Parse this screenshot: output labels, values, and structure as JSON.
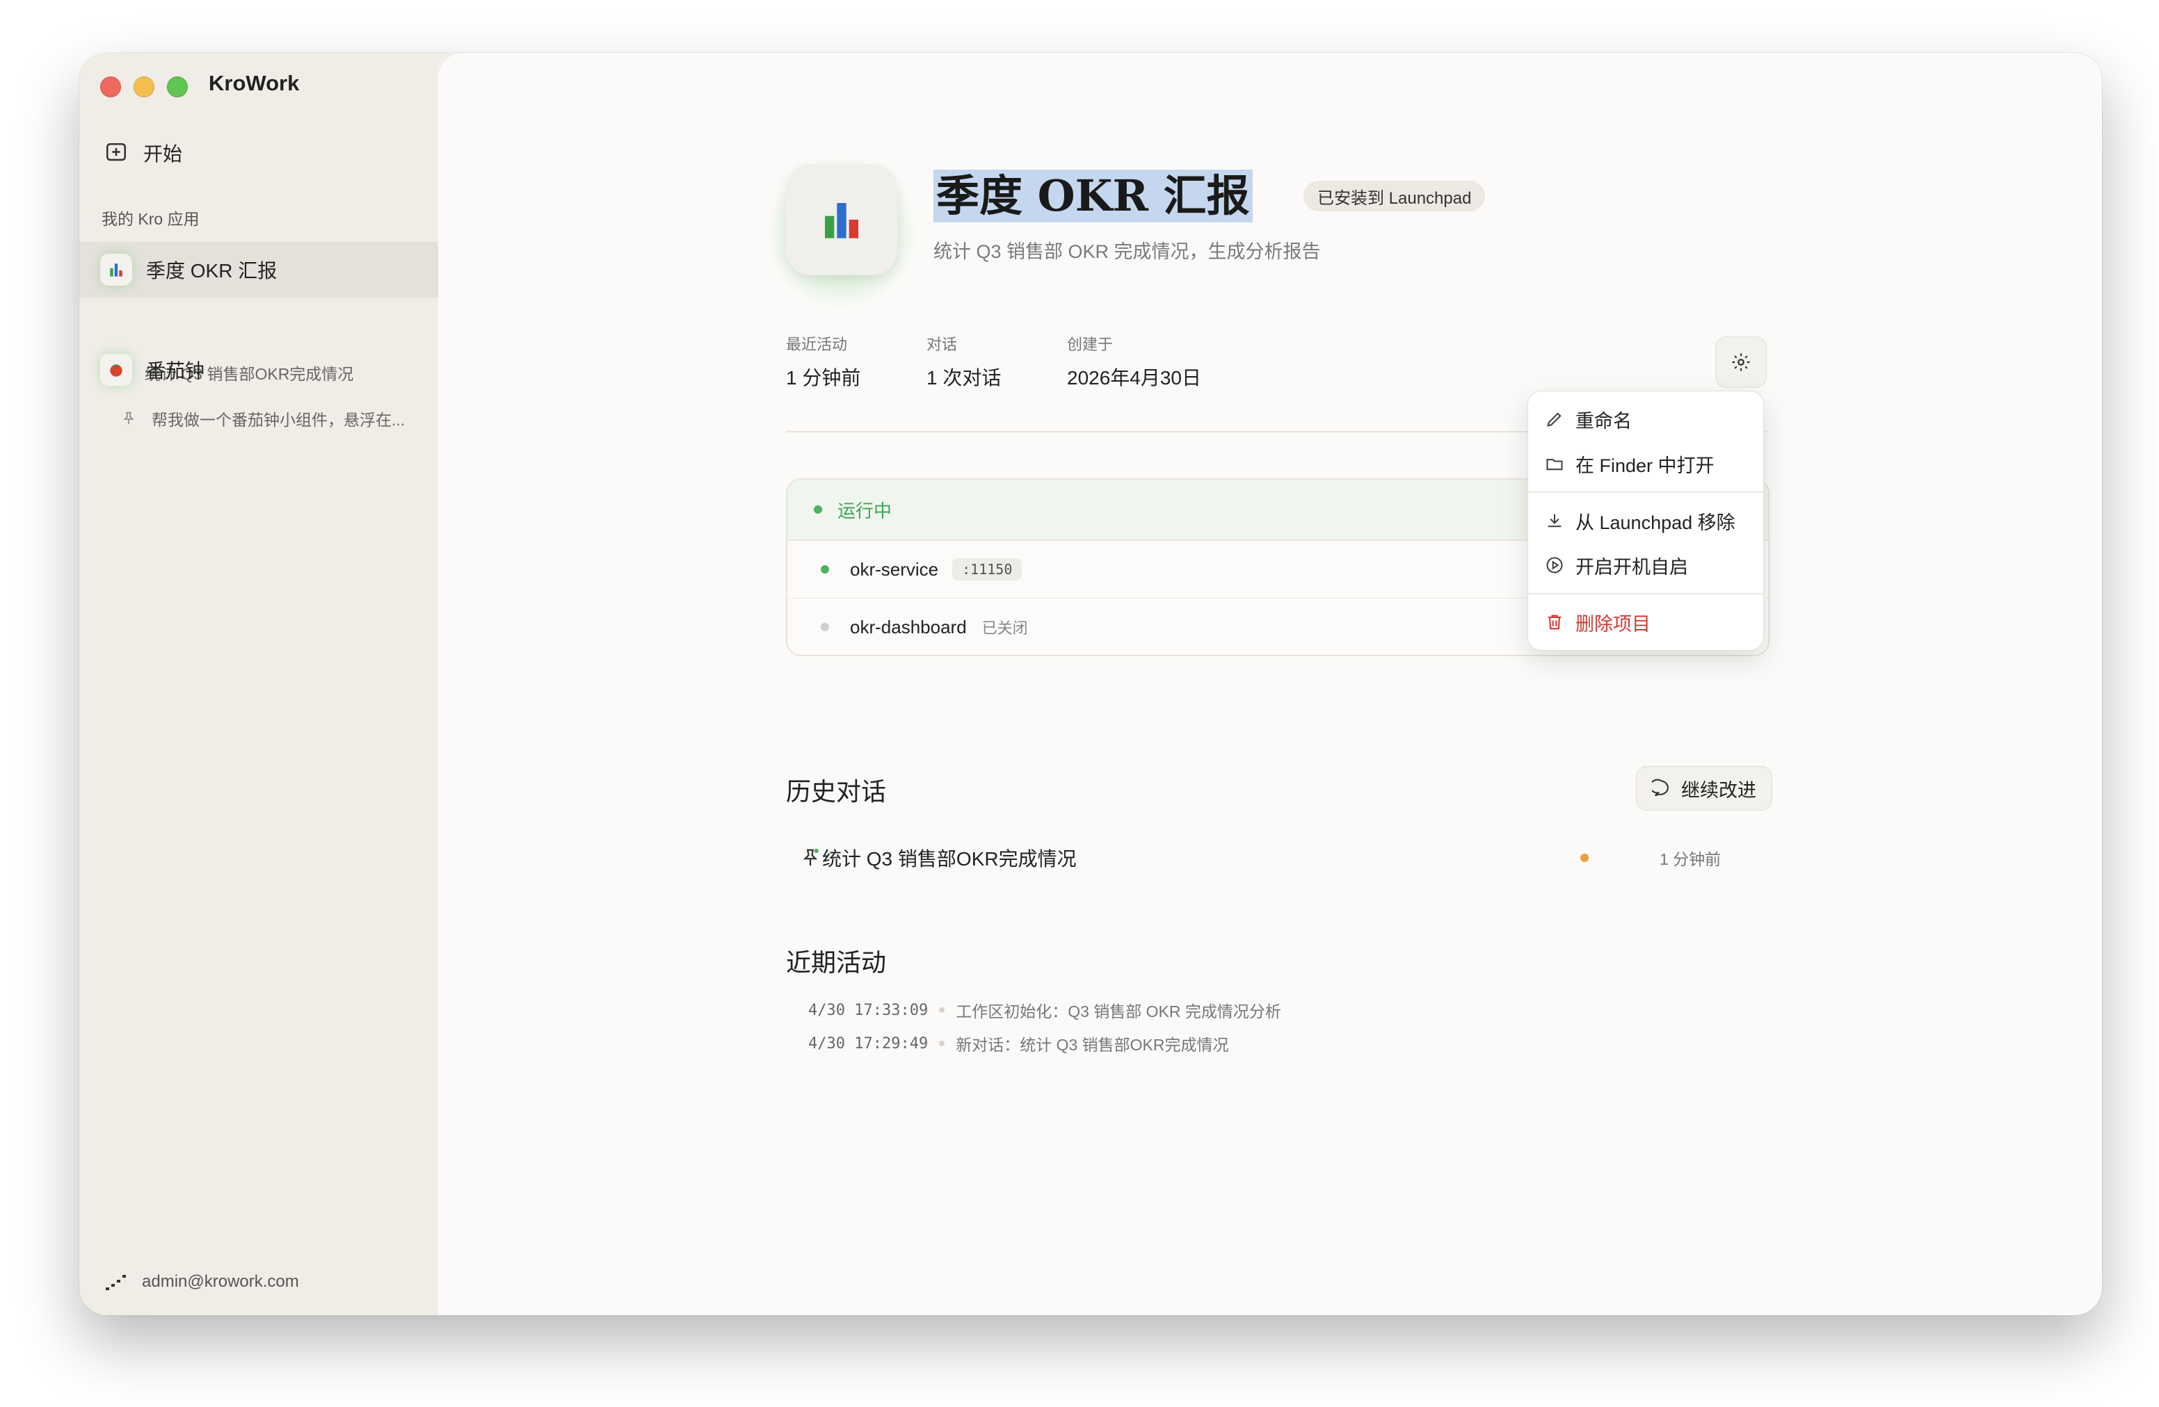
{
  "window": {
    "title": "KroWork"
  },
  "sidebar": {
    "start_label": "开始",
    "section_label": "我的 Kro 应用",
    "apps": [
      {
        "name": "季度 OKR 汇报",
        "icon": "bar-chart-icon",
        "subtitle": "统计 Q3 销售部OKR完成情况",
        "active": true
      },
      {
        "name": "番茄钟",
        "icon": "tomato-icon",
        "subtitle": "帮我做一个番茄钟小组件，悬浮在...",
        "active": false
      }
    ],
    "user_email": "admin@krowork.com"
  },
  "header": {
    "title": "季度 OKR 汇报",
    "badge": "已安装到 Launchpad",
    "description": "统计 Q3 销售部 OKR 完成情况，生成分析报告"
  },
  "meta": [
    {
      "label": "最近活动",
      "value": "1 分钟前"
    },
    {
      "label": "对话",
      "value": "1 次对话"
    },
    {
      "label": "创建于",
      "value": "2026年4月30日"
    }
  ],
  "services": {
    "status": "运行中",
    "items": [
      {
        "name": "okr-service",
        "port": ":11150",
        "running": true
      },
      {
        "name": "okr-dashboard",
        "state": "已关闭",
        "running": false
      }
    ]
  },
  "menu": {
    "rename": "重命名",
    "open_finder": "在 Finder 中打开",
    "remove_launchpad": "从 Launchpad 移除",
    "autostart": "开启开机自启",
    "delete": "删除项目"
  },
  "history": {
    "title": "历史对话",
    "continue_label": "继续改进",
    "items": [
      {
        "title": "统计 Q3 销售部OKR完成情况",
        "time": "1 分钟前"
      }
    ]
  },
  "activity": {
    "title": "近期活动",
    "items": [
      {
        "time": "4/30 17:33:09",
        "text": "工作区初始化：Q3 销售部 OKR 完成情况分析"
      },
      {
        "time": "4/30 17:29:49",
        "text": "新对话：统计 Q3 销售部OKR完成情况"
      }
    ]
  },
  "colors": {
    "accent_green": "#4cb35e",
    "danger": "#d03b35",
    "warning_dot": "#e8a23a",
    "selection": "#c4d7ee"
  }
}
